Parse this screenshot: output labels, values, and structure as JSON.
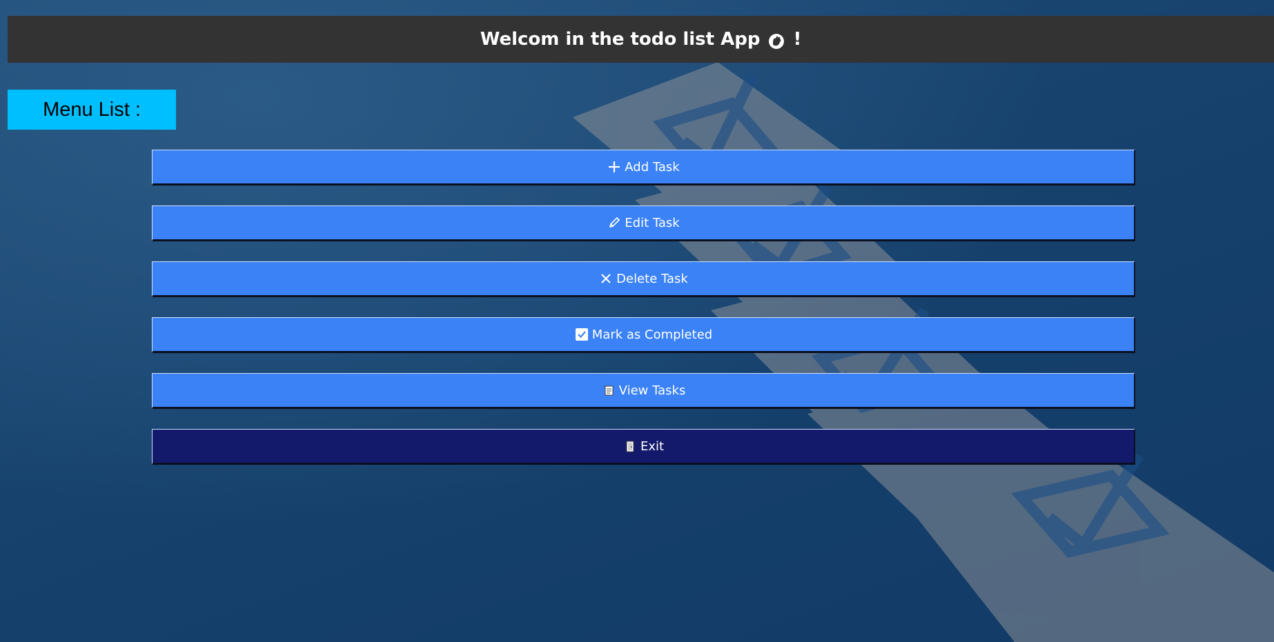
{
  "header": {
    "title": "Welcom in the todo list App",
    "suffix": "!",
    "icon": "waving-hand-icon"
  },
  "menu_label": "Menu List :",
  "menu": [
    {
      "label": "Add Task",
      "icon": "plus-icon"
    },
    {
      "label": "Edit Task",
      "icon": "pencil-icon"
    },
    {
      "label": "Delete Task",
      "icon": "x-icon"
    },
    {
      "label": "Mark as Completed",
      "icon": "checkbox-icon"
    },
    {
      "label": "View Tasks",
      "icon": "scroll-icon"
    },
    {
      "label": "Exit",
      "icon": "door-icon"
    }
  ],
  "colors": {
    "header_bg": "#333333",
    "menu_label_bg": "#00bfff",
    "button_bg": "#3b82f6",
    "exit_button_bg": "#131a6b",
    "page_bg": "#1a4674"
  }
}
